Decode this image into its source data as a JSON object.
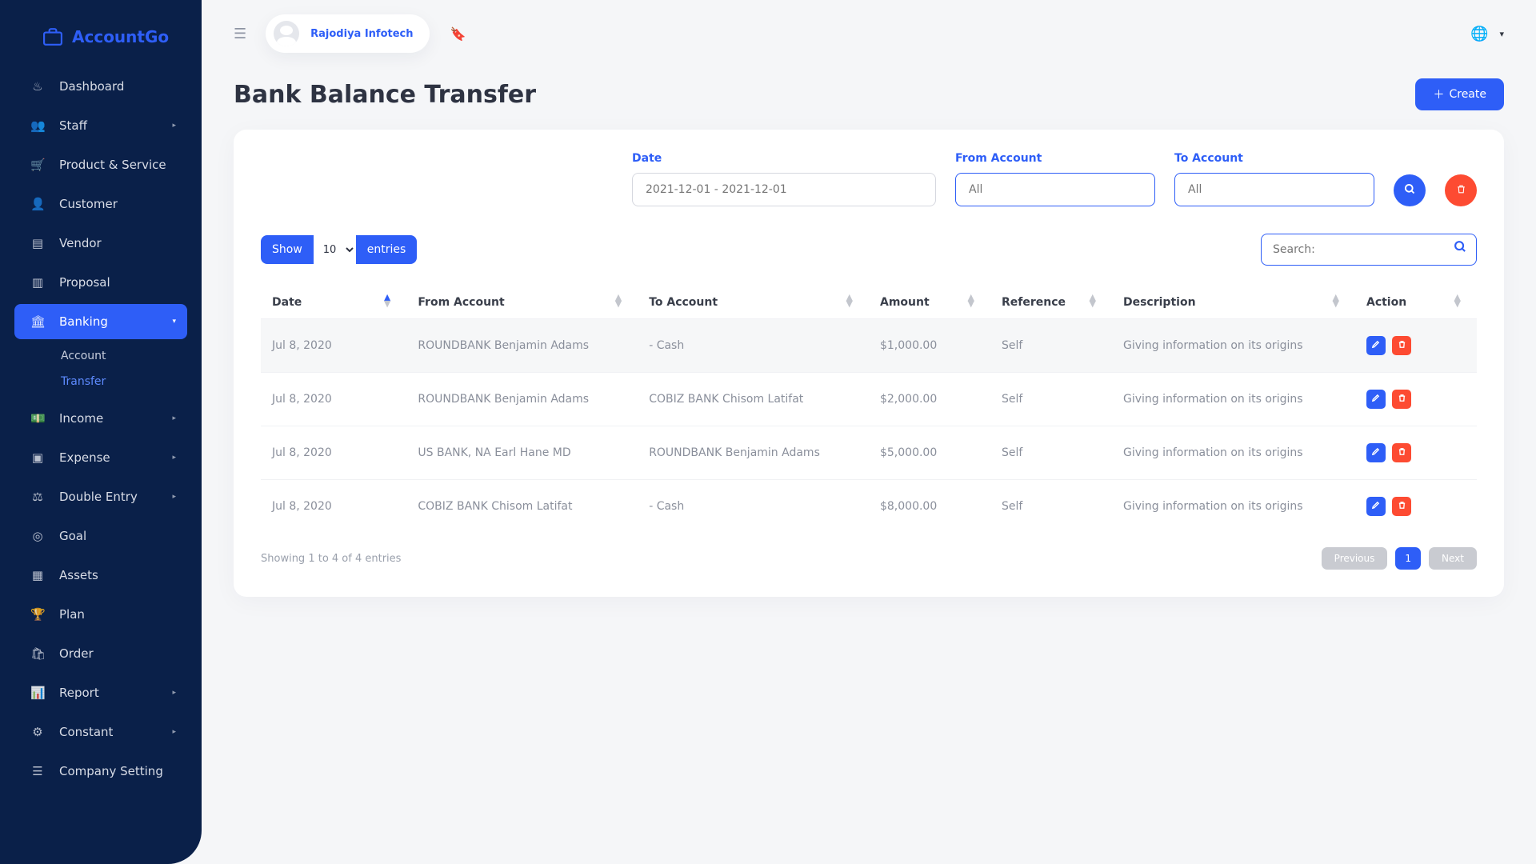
{
  "brand": {
    "name": "AccountGo"
  },
  "user": {
    "name": "Rajodiya Infotech"
  },
  "sidebar": {
    "items": [
      {
        "label": "Dashboard"
      },
      {
        "label": "Staff",
        "caret": true
      },
      {
        "label": "Product & Service"
      },
      {
        "label": "Customer"
      },
      {
        "label": "Vendor"
      },
      {
        "label": "Proposal"
      },
      {
        "label": "Banking",
        "active": true,
        "caret": true,
        "children": [
          {
            "label": "Account"
          },
          {
            "label": "Transfer",
            "active": true
          }
        ]
      },
      {
        "label": "Income",
        "caret": true
      },
      {
        "label": "Expense",
        "caret": true
      },
      {
        "label": "Double Entry",
        "caret": true
      },
      {
        "label": "Goal"
      },
      {
        "label": "Assets"
      },
      {
        "label": "Plan"
      },
      {
        "label": "Order"
      },
      {
        "label": "Report",
        "caret": true
      },
      {
        "label": "Constant",
        "caret": true
      },
      {
        "label": "Company Setting"
      }
    ]
  },
  "page": {
    "title": "Bank Balance Transfer",
    "create_label": "Create"
  },
  "filters": {
    "date_label": "Date",
    "date_placeholder": "2021-12-01 - 2021-12-01",
    "from_label": "From Account",
    "from_placeholder": "All",
    "to_label": "To Account",
    "to_placeholder": "All"
  },
  "toolbar": {
    "show_prefix": "Show",
    "show_suffix": "entries",
    "show_selected": "10",
    "search_label": "Search:"
  },
  "table": {
    "headers": {
      "date": "Date",
      "from_account": "From Account",
      "to_account": "To Account",
      "amount": "Amount",
      "reference": "Reference",
      "description": "Description",
      "action": "Action"
    },
    "rows": [
      {
        "date": "Jul 8, 2020",
        "from": "ROUNDBANK Benjamin Adams",
        "to": "- Cash",
        "amount": "$1,000.00",
        "reference": "Self",
        "description": "Giving information on its origins"
      },
      {
        "date": "Jul 8, 2020",
        "from": "ROUNDBANK Benjamin Adams",
        "to": "COBIZ BANK Chisom Latifat",
        "amount": "$2,000.00",
        "reference": "Self",
        "description": "Giving information on its origins"
      },
      {
        "date": "Jul 8, 2020",
        "from": "US BANK, NA Earl Hane MD",
        "to": "ROUNDBANK Benjamin Adams",
        "amount": "$5,000.00",
        "reference": "Self",
        "description": "Giving information on its origins"
      },
      {
        "date": "Jul 8, 2020",
        "from": "COBIZ BANK Chisom Latifat",
        "to": "- Cash",
        "amount": "$8,000.00",
        "reference": "Self",
        "description": "Giving information on its origins"
      }
    ],
    "info": "Showing 1 to 4 of 4 entries"
  },
  "pager": {
    "previous": "Previous",
    "page": "1",
    "next": "Next"
  }
}
